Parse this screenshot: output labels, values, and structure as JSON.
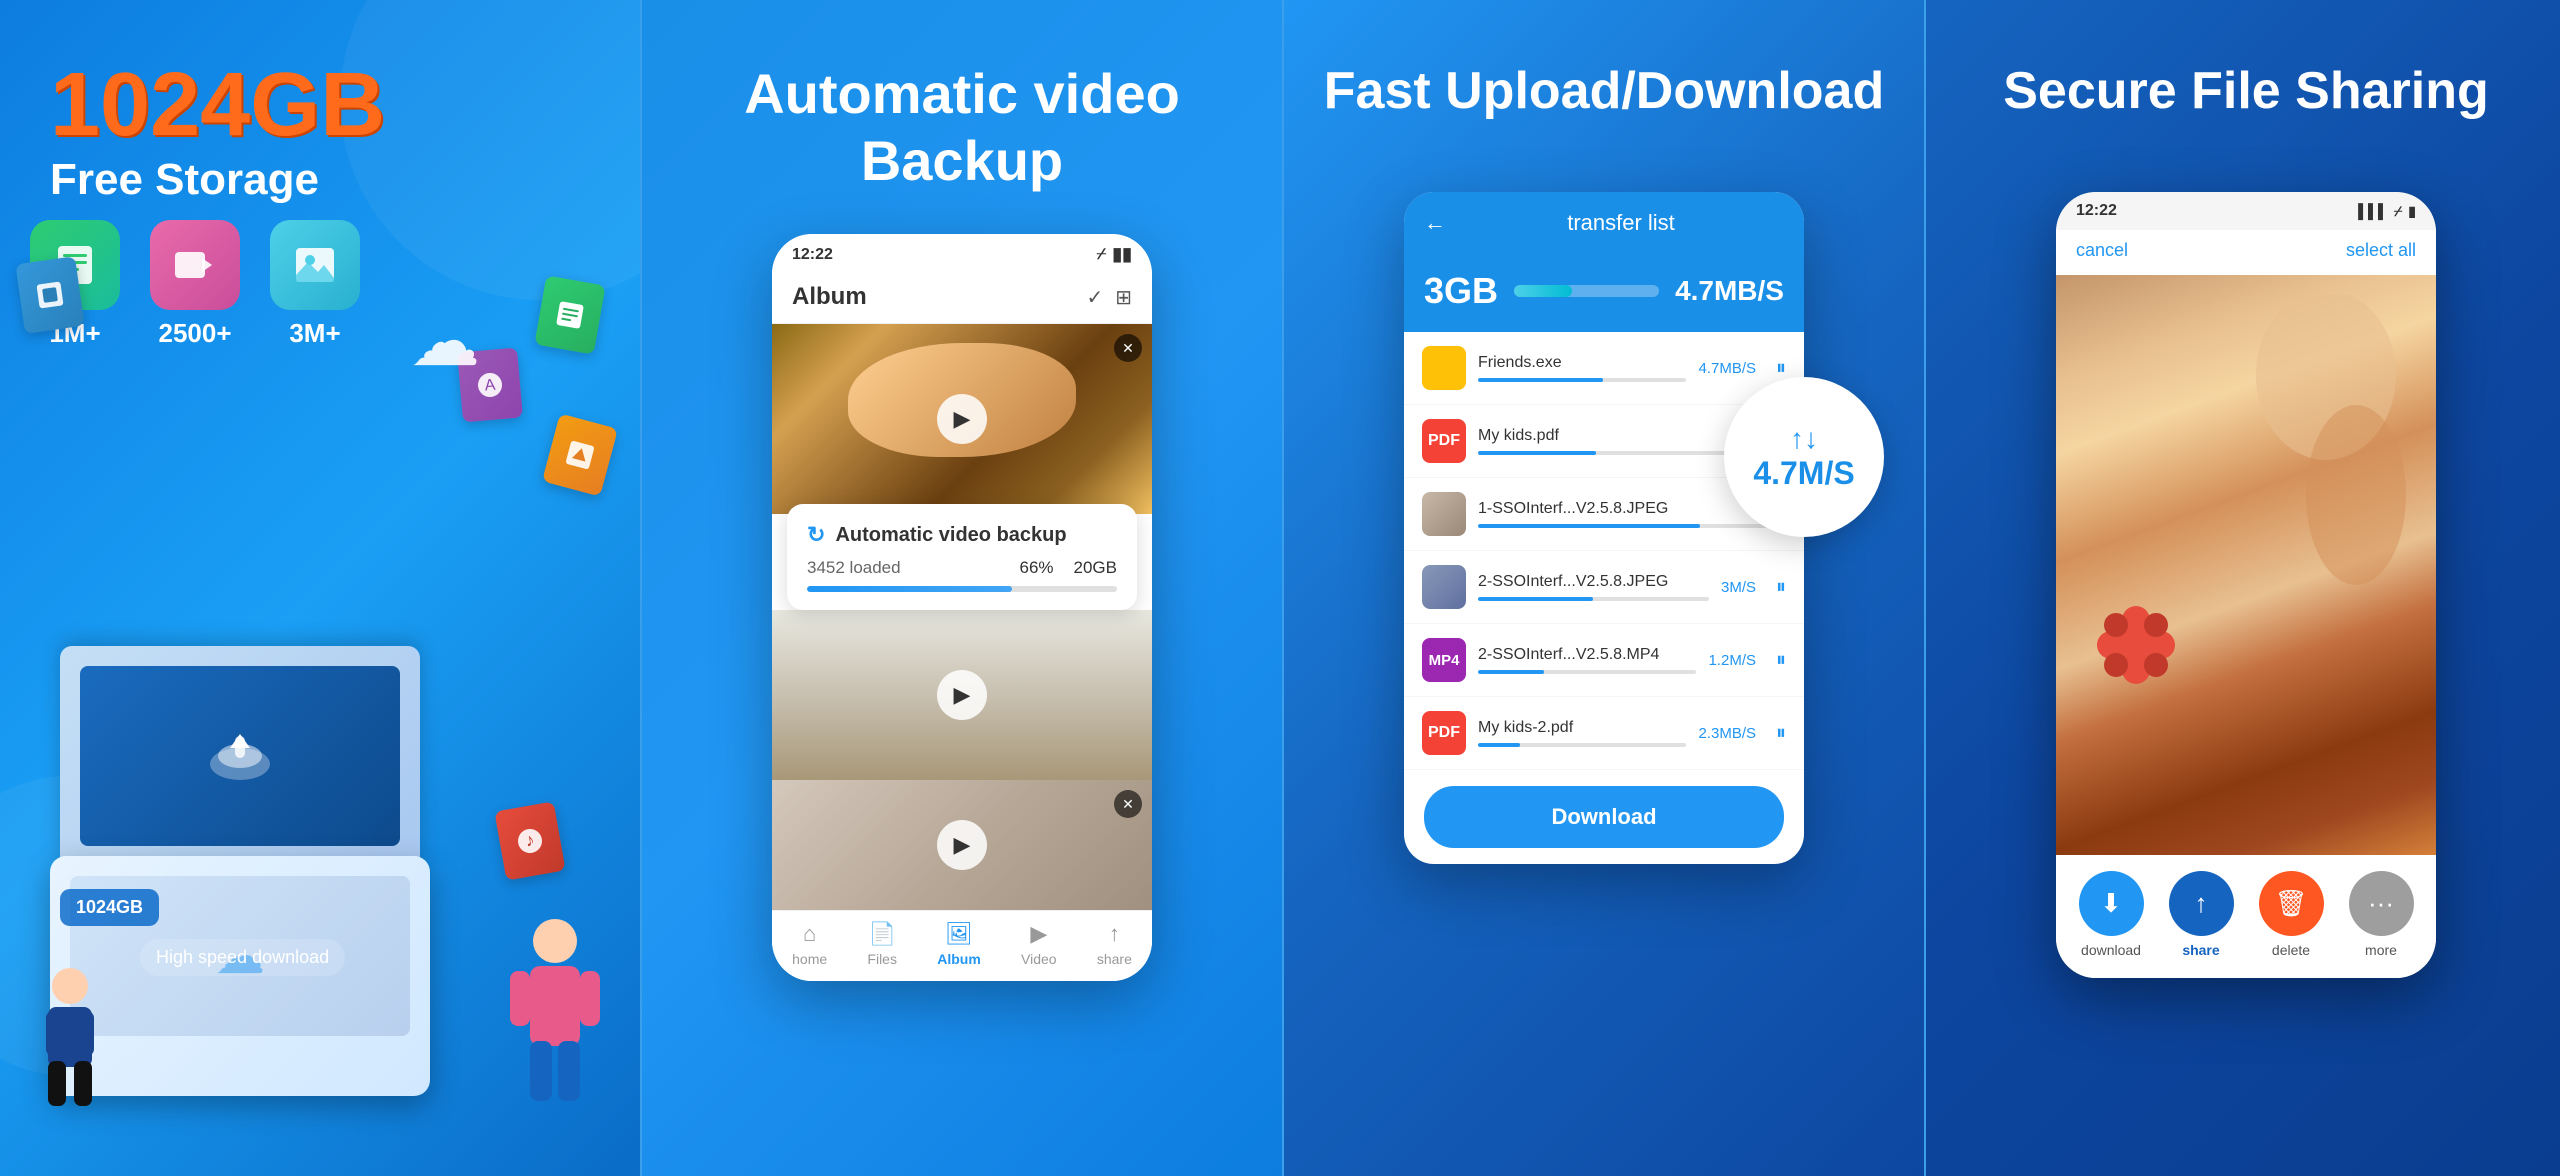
{
  "section1": {
    "storage_size": "1024GB",
    "storage_label": "Free Storage",
    "icons": [
      {
        "label": "1M+",
        "type": "document",
        "color": "green"
      },
      {
        "label": "2500+",
        "type": "video",
        "color": "pink"
      },
      {
        "label": "3M+",
        "type": "photo",
        "color": "cyan"
      }
    ],
    "download_label": "High speed download",
    "storage_badge": "1024GB"
  },
  "section2": {
    "title": "Automatic video\nBackup",
    "phone": {
      "time": "12:22",
      "album_label": "Album",
      "backup_popup": {
        "title": "Automatic video backup",
        "loaded": "3452 loaded",
        "percent": "66%",
        "size": "20GB",
        "progress": 66
      },
      "nav_items": [
        "home",
        "Files",
        "Album",
        "Video",
        "share"
      ],
      "active_nav": "Album"
    }
  },
  "section3": {
    "title": "Fast Upload/Download",
    "phone": {
      "transfer_list_label": "transfer list",
      "speed_gb": "3GB",
      "speed_mbs": "4.7MB/S",
      "files": [
        {
          "name": "Friends.exe",
          "speed": "4.7MB/S",
          "icon": "folder",
          "progress": 60
        },
        {
          "name": "My kids.pdf",
          "speed": "",
          "icon": "pdf",
          "progress": 40
        },
        {
          "name": "1-SSOInterf...V2.5.8.JPEG",
          "speed": "",
          "icon": "jpeg",
          "progress": 75
        },
        {
          "name": "2-SSOInterf...V2.5.8.JPEG",
          "speed": "3M/S",
          "icon": "jpeg2",
          "progress": 50
        },
        {
          "name": "2-SSOInterf...V2.5.8.MP4",
          "speed": "1.2M/S",
          "icon": "mp4",
          "progress": 30
        },
        {
          "name": "My kids-2.pdf",
          "speed": "2.3MB/S",
          "icon": "pdf2",
          "progress": 20
        }
      ],
      "download_btn": "Download",
      "speed_badge": "4.7M/S"
    }
  },
  "section4": {
    "title": "Secure File Sharing",
    "phone": {
      "time": "12:22",
      "cancel": "cancel",
      "select_all": "select all",
      "actions": [
        {
          "label": "download",
          "icon": "⬇"
        },
        {
          "label": "share",
          "icon": "↑"
        },
        {
          "label": "delete",
          "icon": "🗑"
        },
        {
          "label": "more",
          "icon": "···"
        }
      ]
    }
  }
}
